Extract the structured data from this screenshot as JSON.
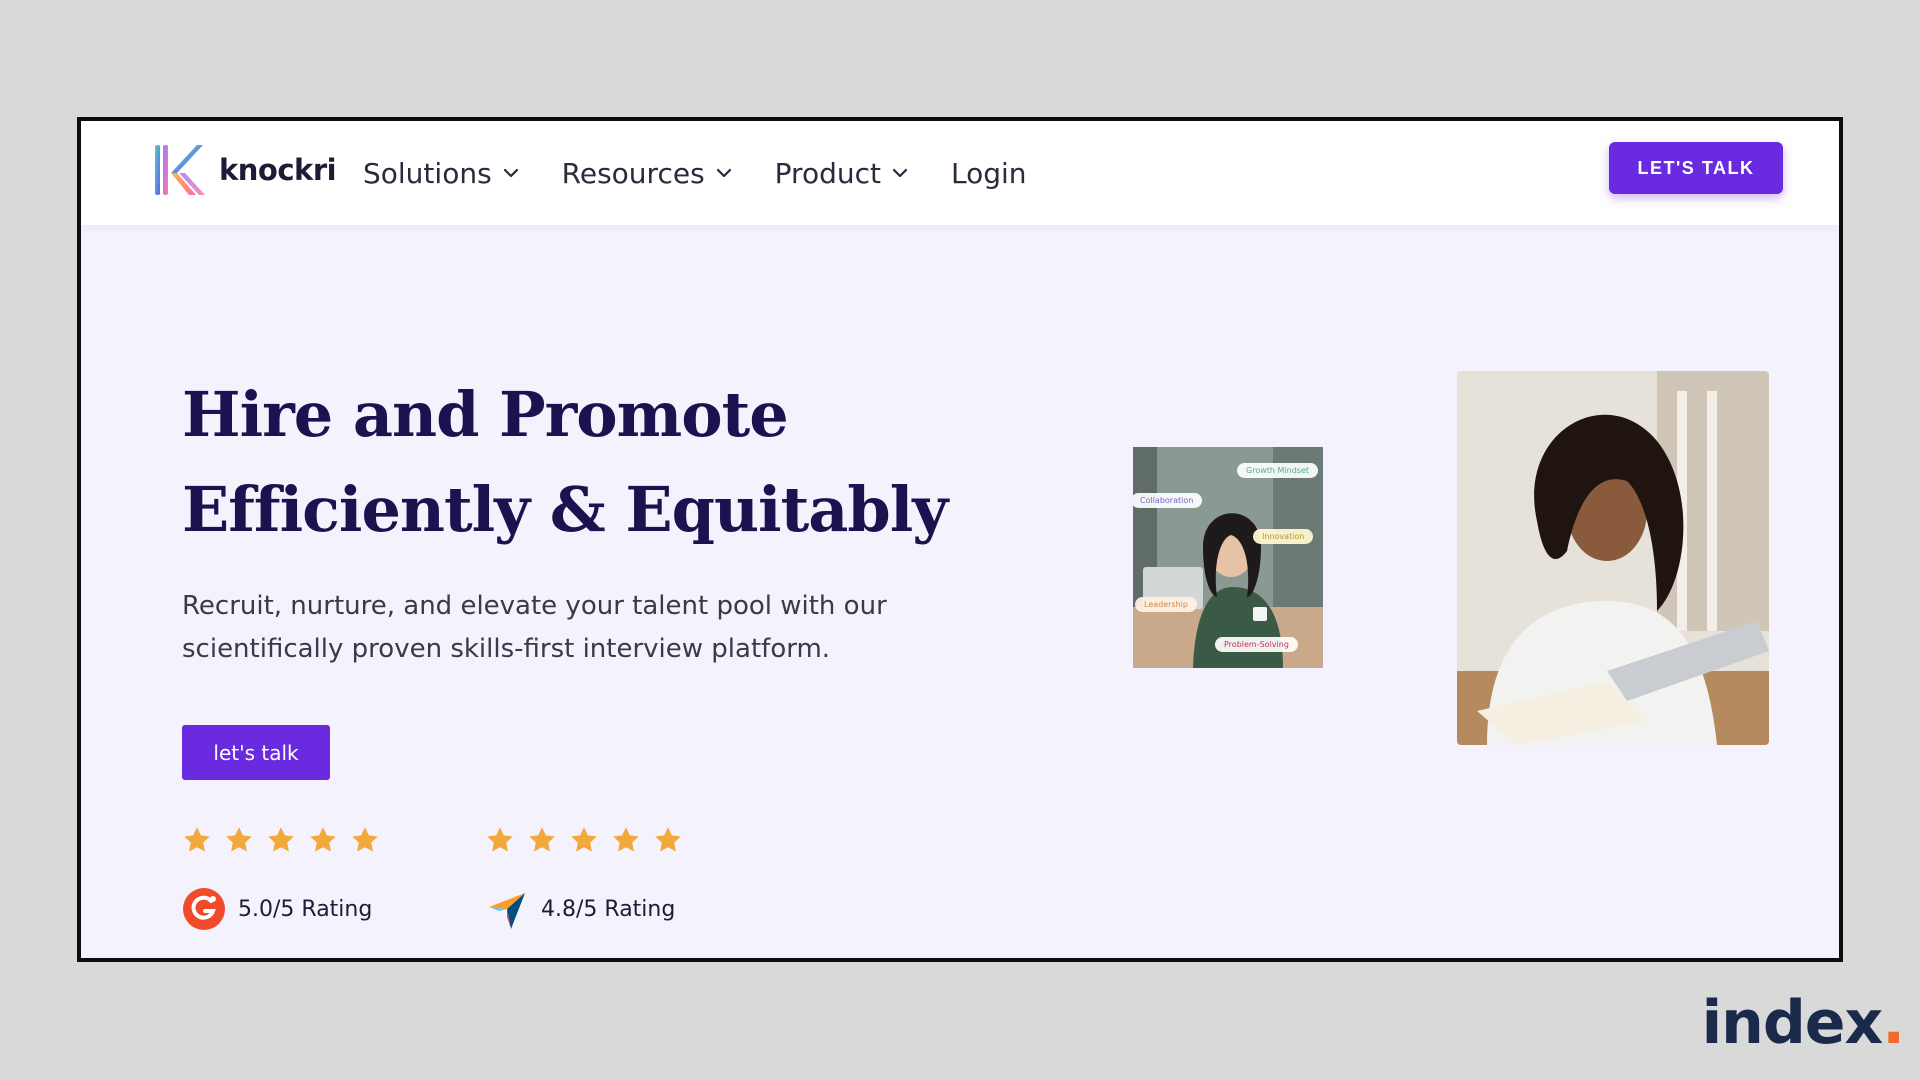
{
  "brand": {
    "name": "knockri",
    "accent": "#6a2be0",
    "heading_color": "#1b1250"
  },
  "nav": {
    "items": [
      {
        "label": "Solutions",
        "has_dropdown": true
      },
      {
        "label": "Resources",
        "has_dropdown": true
      },
      {
        "label": "Product",
        "has_dropdown": true
      },
      {
        "label": "Login",
        "has_dropdown": false
      }
    ],
    "cta_label": "LET'S TALK"
  },
  "hero": {
    "title_line1": "Hire and Promote",
    "title_line2": "Efficiently & Equitably",
    "subtitle_line1": "Recruit, nurture, and elevate your talent pool with our",
    "subtitle_line2": "scientifically proven skills-first interview platform.",
    "cta_label": "let's talk"
  },
  "ratings": [
    {
      "source_icon": "g2-logo-icon",
      "stars": 5,
      "text": "5.0/5 Rating"
    },
    {
      "source_icon": "capterra-logo-icon",
      "stars": 5,
      "text": "4.8/5 Rating"
    }
  ],
  "image_tags": {
    "tag1": "Growth Mindset",
    "tag2": "Collaboration",
    "tag3": "Innovation",
    "tag4": "Leadership",
    "tag5": "Problem-Solving"
  },
  "watermark": {
    "text": "index",
    "dot": "."
  }
}
